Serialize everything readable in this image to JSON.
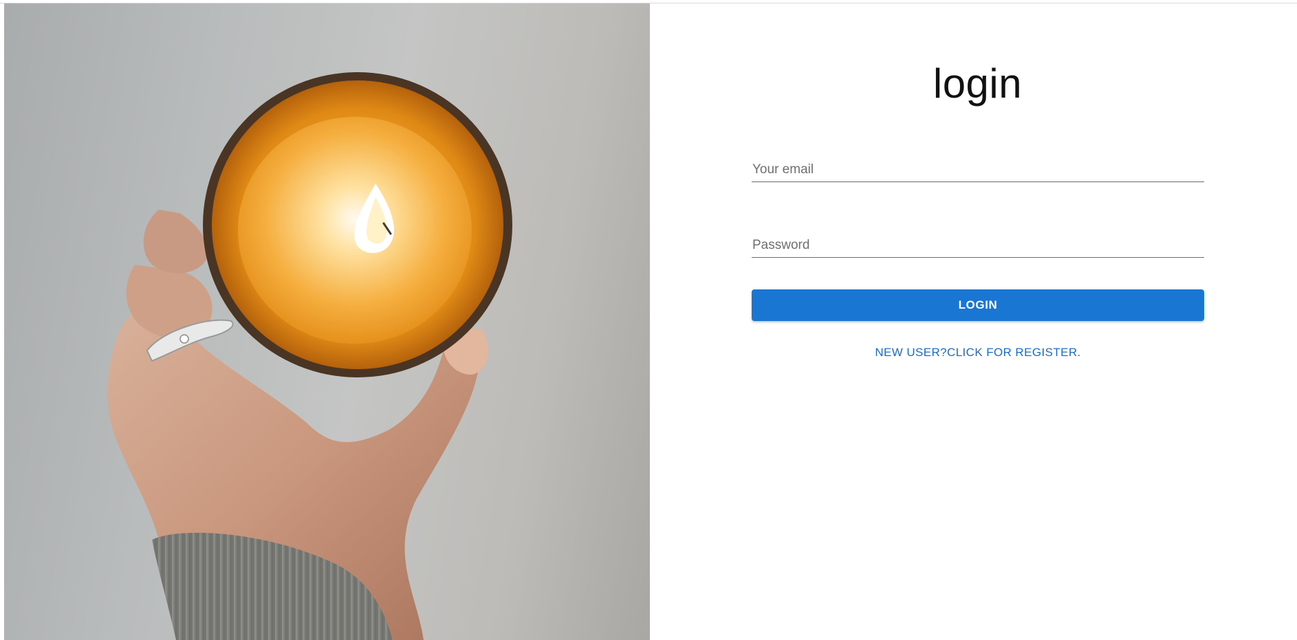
{
  "hero_image": {
    "description_icon": "candle-photo"
  },
  "login_form": {
    "title": "login",
    "email_placeholder": "Your email",
    "email_value": "",
    "password_placeholder": "Password",
    "password_value": "",
    "submit_label": "LOGIN",
    "register_link_label": "NEW USER?CLICK FOR REGISTER."
  },
  "colors": {
    "primary": "#1976d2",
    "link": "#1a6cc6",
    "background": "#ffffff"
  }
}
